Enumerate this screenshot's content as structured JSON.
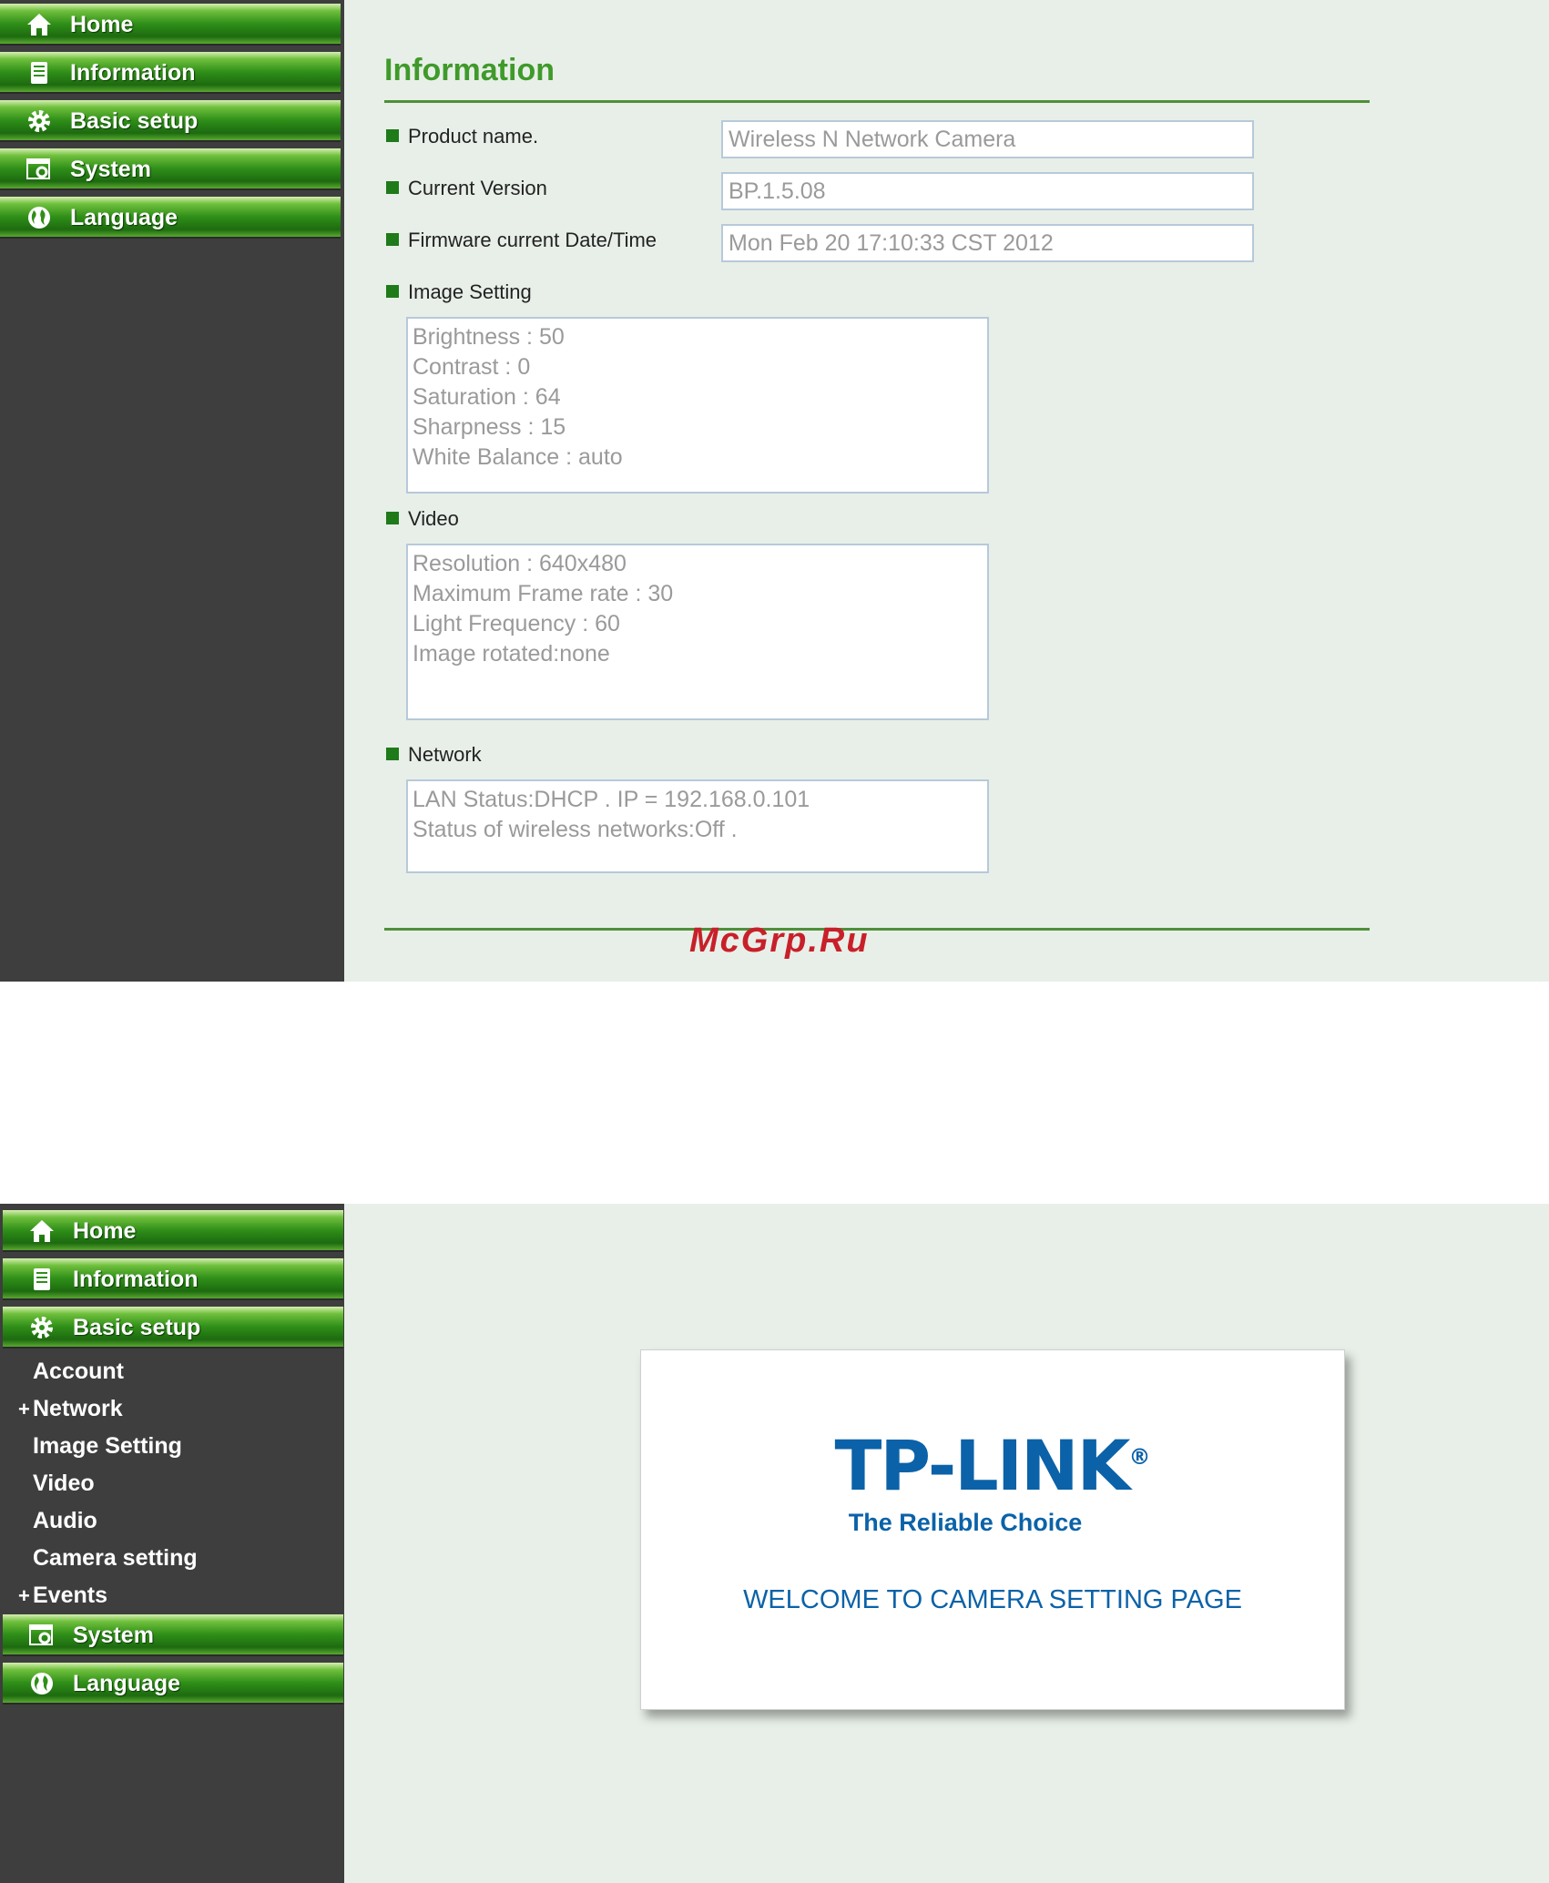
{
  "nav": {
    "home": "Home",
    "information": "Information",
    "basic_setup": "Basic setup",
    "system": "System",
    "language": "Language"
  },
  "basic_setup_submenu": {
    "account": "Account",
    "network": "Network",
    "image_setting": "Image Setting",
    "video": "Video",
    "audio": "Audio",
    "camera_setting": "Camera setting",
    "events": "Events",
    "expand_symbol": "+"
  },
  "info_page": {
    "title": "Information",
    "product_name_label": "Product name.",
    "product_name_value": "Wireless N Network Camera",
    "current_version_label": "Current Version",
    "current_version_value": "BP.1.5.08",
    "firmware_datetime_label": "Firmware current Date/Time",
    "firmware_datetime_value": "Mon Feb 20 17:10:33 CST 2012",
    "image_setting_label": "Image Setting",
    "image_setting_lines": [
      "Brightness : 50",
      "Contrast : 0",
      "Saturation : 64",
      "Sharpness : 15",
      "White Balance : auto"
    ],
    "video_label": "Video",
    "video_lines": [
      "Resolution : 640x480",
      "Maximum Frame rate : 30",
      "Light Frequency : 60",
      "Image rotated:none"
    ],
    "network_label": "Network",
    "network_lines": [
      "LAN Status:DHCP . IP = 192.168.0.101",
      "Status of wireless networks:Off ."
    ]
  },
  "watermark": "McGrp.Ru",
  "welcome_page": {
    "logo_text": "TP-LINK",
    "logo_mark": "®",
    "tagline": "The Reliable Choice",
    "welcome_text": "WELCOME TO CAMERA SETTING PAGE"
  },
  "icons": [
    "home-icon",
    "information-icon",
    "gear-icon",
    "system-icon",
    "globe-icon"
  ],
  "colors": {
    "sidebar_bg": "#3e3e3e",
    "content_bg": "#e8efe8",
    "nav_green": "#2f8f18",
    "title_green": "#3f9a2a",
    "brand_blue": "#0b62a8",
    "watermark_red": "#c8202a"
  }
}
